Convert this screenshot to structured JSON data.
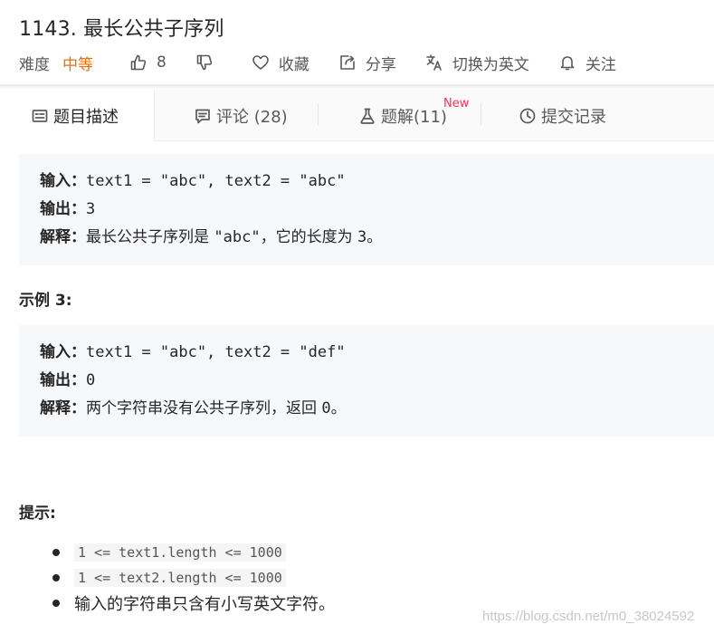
{
  "problem": {
    "title": "1143. 最长公共子序列",
    "difficulty_label": "难度",
    "difficulty": "中等",
    "likes": "8",
    "favorite_label": "收藏",
    "share_label": "分享",
    "switch_lang_label": "切换为英文",
    "follow_label": "关注"
  },
  "tabs": {
    "description": "题目描述",
    "comments": "评论 (28)",
    "solutions": "题解(11)",
    "solutions_badge": "New",
    "submissions": "提交记录"
  },
  "example2": {
    "input_label": "输入：",
    "input_value": "text1 = \"abc\", text2 = \"abc\"",
    "output_label": "输出：",
    "output_value": "3",
    "explain_label": "解释：",
    "explain_text": "最长公共子序列是 ",
    "explain_code": "\"abc\"",
    "explain_text2": "，它的长度为 ",
    "explain_code2": "3",
    "explain_end": "。"
  },
  "example3": {
    "heading": "示例 3:",
    "input_label": "输入：",
    "input_value": "text1 = \"abc\", text2 = \"def\"",
    "output_label": "输出：",
    "output_value": "0",
    "explain_label": "解释：",
    "explain_text": "两个字符串没有公共子序列，返回 ",
    "explain_code": "0",
    "explain_end": "。"
  },
  "hints": {
    "heading": "提示:",
    "items": [
      "1 <= text1.length <= 1000",
      "1 <= text2.length <= 1000",
      "输入的字符串只含有小写英文字符。"
    ]
  },
  "watermark": "https://blog.csdn.net/m0_38024592"
}
